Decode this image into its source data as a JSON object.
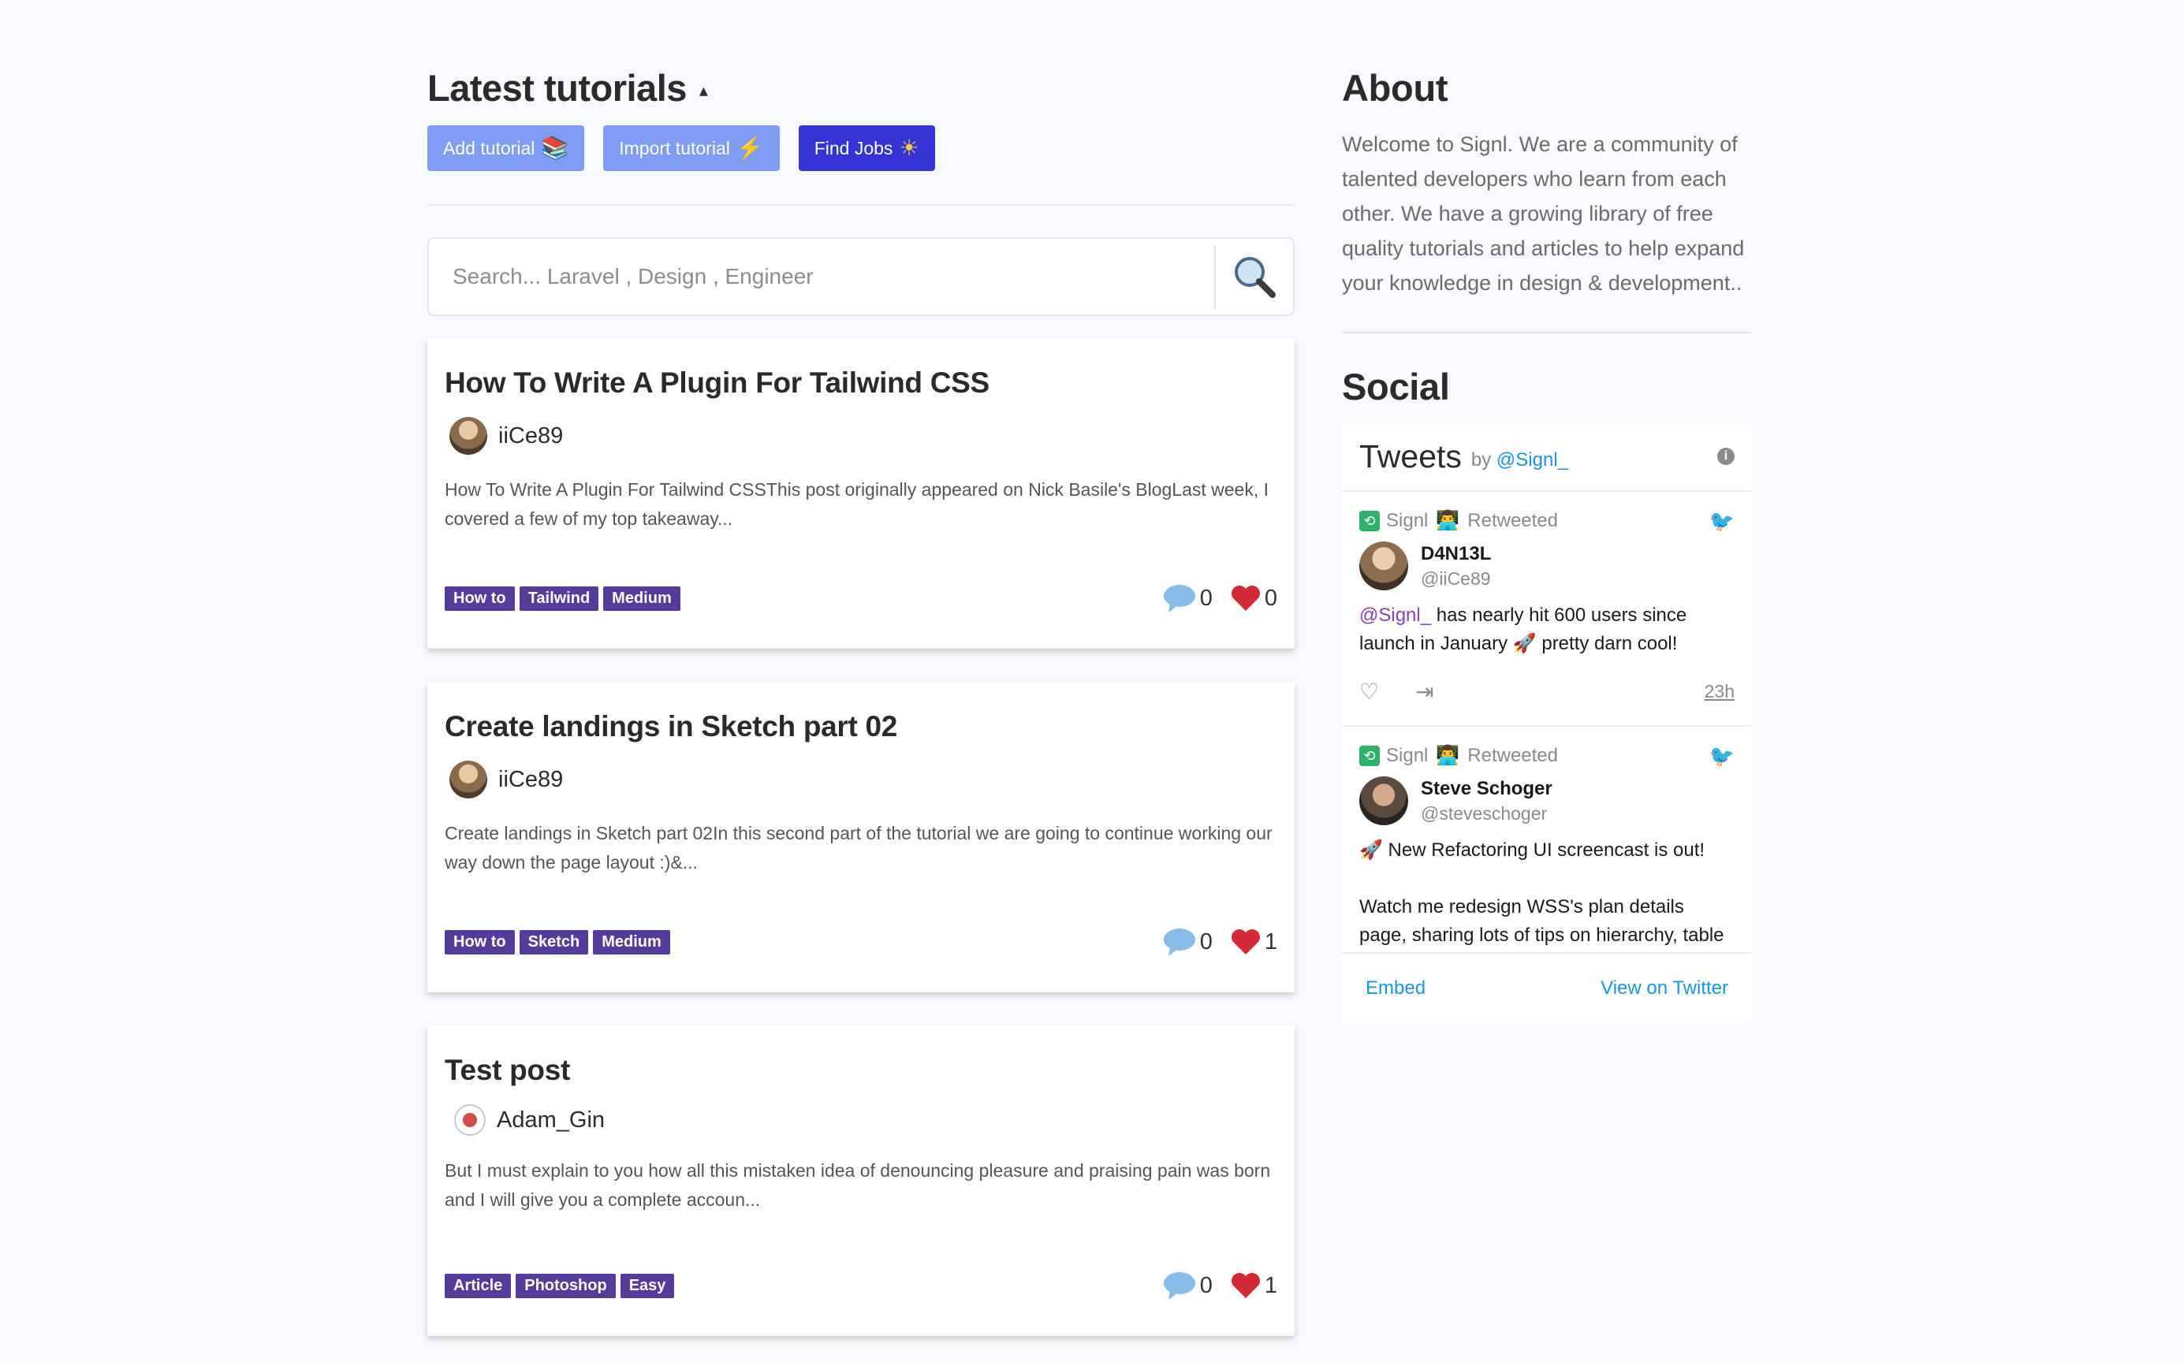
{
  "left": {
    "title": "Latest tutorials",
    "caret": "▴",
    "buttons": {
      "add_label": "Add tutorial",
      "add_icon": "📚",
      "import_label": "Import tutorial",
      "import_icon": "⚡",
      "jobs_label": "Find Jobs",
      "jobs_icon": "☀"
    },
    "search": {
      "placeholder": "Search... Laravel , Design , Engineer",
      "value": ""
    },
    "posts": [
      {
        "title": "How To Write A Plugin For Tailwind CSS",
        "author": "iiCe89",
        "excerpt": "How To Write A Plugin For Tailwind CSSThis post originally appeared on Nick Basile's BlogLast week, I covered a few of my top takeaway...",
        "tags": [
          "How to",
          "Tailwind",
          "Medium"
        ],
        "comments": "0",
        "likes": "0"
      },
      {
        "title": "Create landings in Sketch part 02",
        "author": "iiCe89",
        "excerpt": "Create landings in Sketch part 02In this second part of the tutorial we are going to  continue working our way down the page layout :)&...",
        "tags": [
          "How to",
          "Sketch",
          "Medium"
        ],
        "comments": "0",
        "likes": "1"
      },
      {
        "title": "Test post",
        "author": "Adam_Gin",
        "excerpt": "But I must explain to you how all this mistaken idea of denouncing pleasure and praising pain was born and I will give you a complete accoun...",
        "tags": [
          "Article",
          "Photoshop",
          "Easy"
        ],
        "comments": "0",
        "likes": "1"
      }
    ]
  },
  "right": {
    "about_title": "About",
    "about_text": "Welcome to Signl. We are a community of talented developers who learn from each other. We have a growing library of free quality tutorials and articles to help expand your knowledge in design & development..",
    "social_title": "Social",
    "widget": {
      "title": "Tweets",
      "by": "by",
      "handle": "@Signl_",
      "info": "i",
      "embed": "Embed",
      "view": "View on Twitter",
      "tweets": [
        {
          "retweeter": "Signl",
          "retweeter_emoji": "👨‍💻",
          "retweeted": "Retweeted",
          "name": "D4N13L",
          "handle": "@iiCe89",
          "mention": "@Signl_",
          "body": " has nearly hit 600 users since launch in January 🚀 pretty darn cool!",
          "time": "23h"
        },
        {
          "retweeter": "Signl",
          "retweeter_emoji": "👨‍💻",
          "retweeted": "Retweeted",
          "name": "Steve Schoger",
          "handle": "@steveschoger",
          "body_line1": "🚀 New Refactoring UI screencast is out!",
          "body_line2": "Watch me redesign WSS's plan details page, sharing lots of tips on hierarchy, table design"
        }
      ]
    }
  }
}
